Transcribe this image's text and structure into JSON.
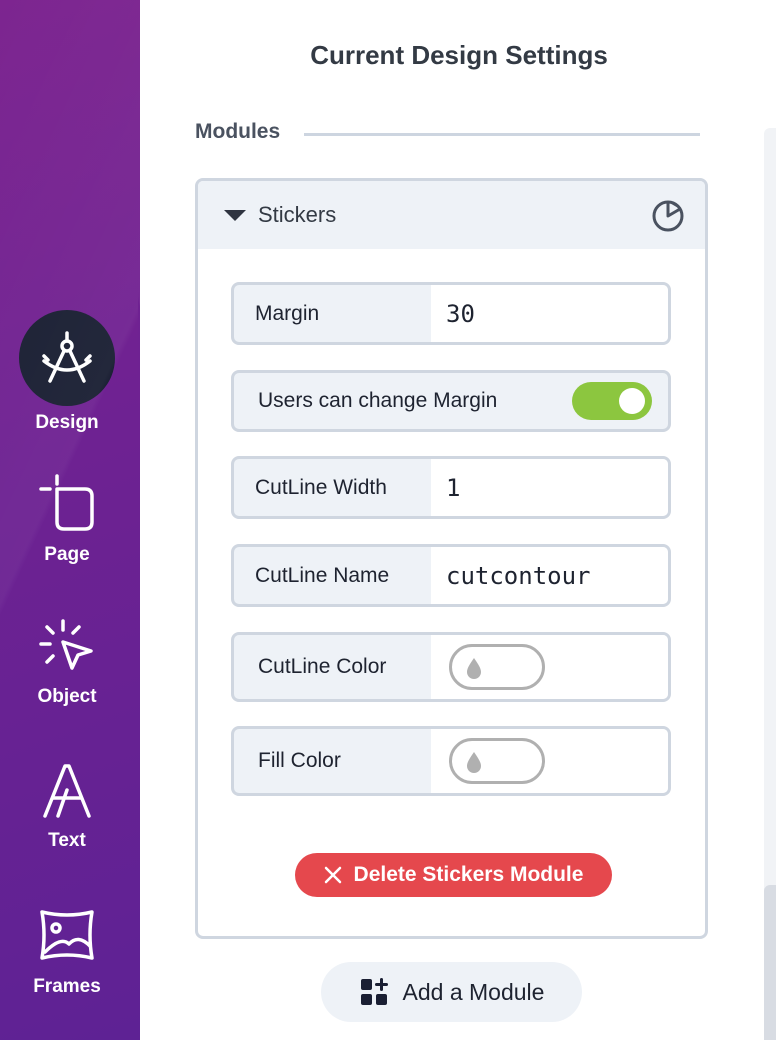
{
  "sidebar": {
    "items": [
      {
        "label": "Design",
        "icon": "compass-icon",
        "active": true
      },
      {
        "label": "Page",
        "icon": "page-crop-icon"
      },
      {
        "label": "Object",
        "icon": "cursor-click-icon"
      },
      {
        "label": "Text",
        "icon": "text-a-icon"
      },
      {
        "label": "Frames",
        "icon": "frame-image-icon"
      }
    ]
  },
  "header": {
    "title": "Current Design Settings"
  },
  "modules": {
    "section_label": "Modules",
    "stickers": {
      "name": "Stickers",
      "icon": "pie-chart-icon",
      "fields": {
        "margin": {
          "label": "Margin",
          "value": "30"
        },
        "users_change_margin": {
          "label": "Users can change Margin",
          "enabled": true
        },
        "cutline_width": {
          "label": "CutLine Width",
          "value": "1"
        },
        "cutline_name": {
          "label": "CutLine Name",
          "value": "cutcontour"
        },
        "cutline_color": {
          "label": "CutLine Color",
          "icon": "droplet-icon"
        },
        "fill_color": {
          "label": "Fill Color",
          "icon": "droplet-icon"
        }
      },
      "delete_label": "Delete Stickers Module"
    },
    "add_label": "Add a Module"
  },
  "colors": {
    "sidebar_purple": "#6f2292",
    "active_nav": "#1a1f33",
    "toggle_on": "#8cc63f",
    "danger": "#e5484d"
  }
}
